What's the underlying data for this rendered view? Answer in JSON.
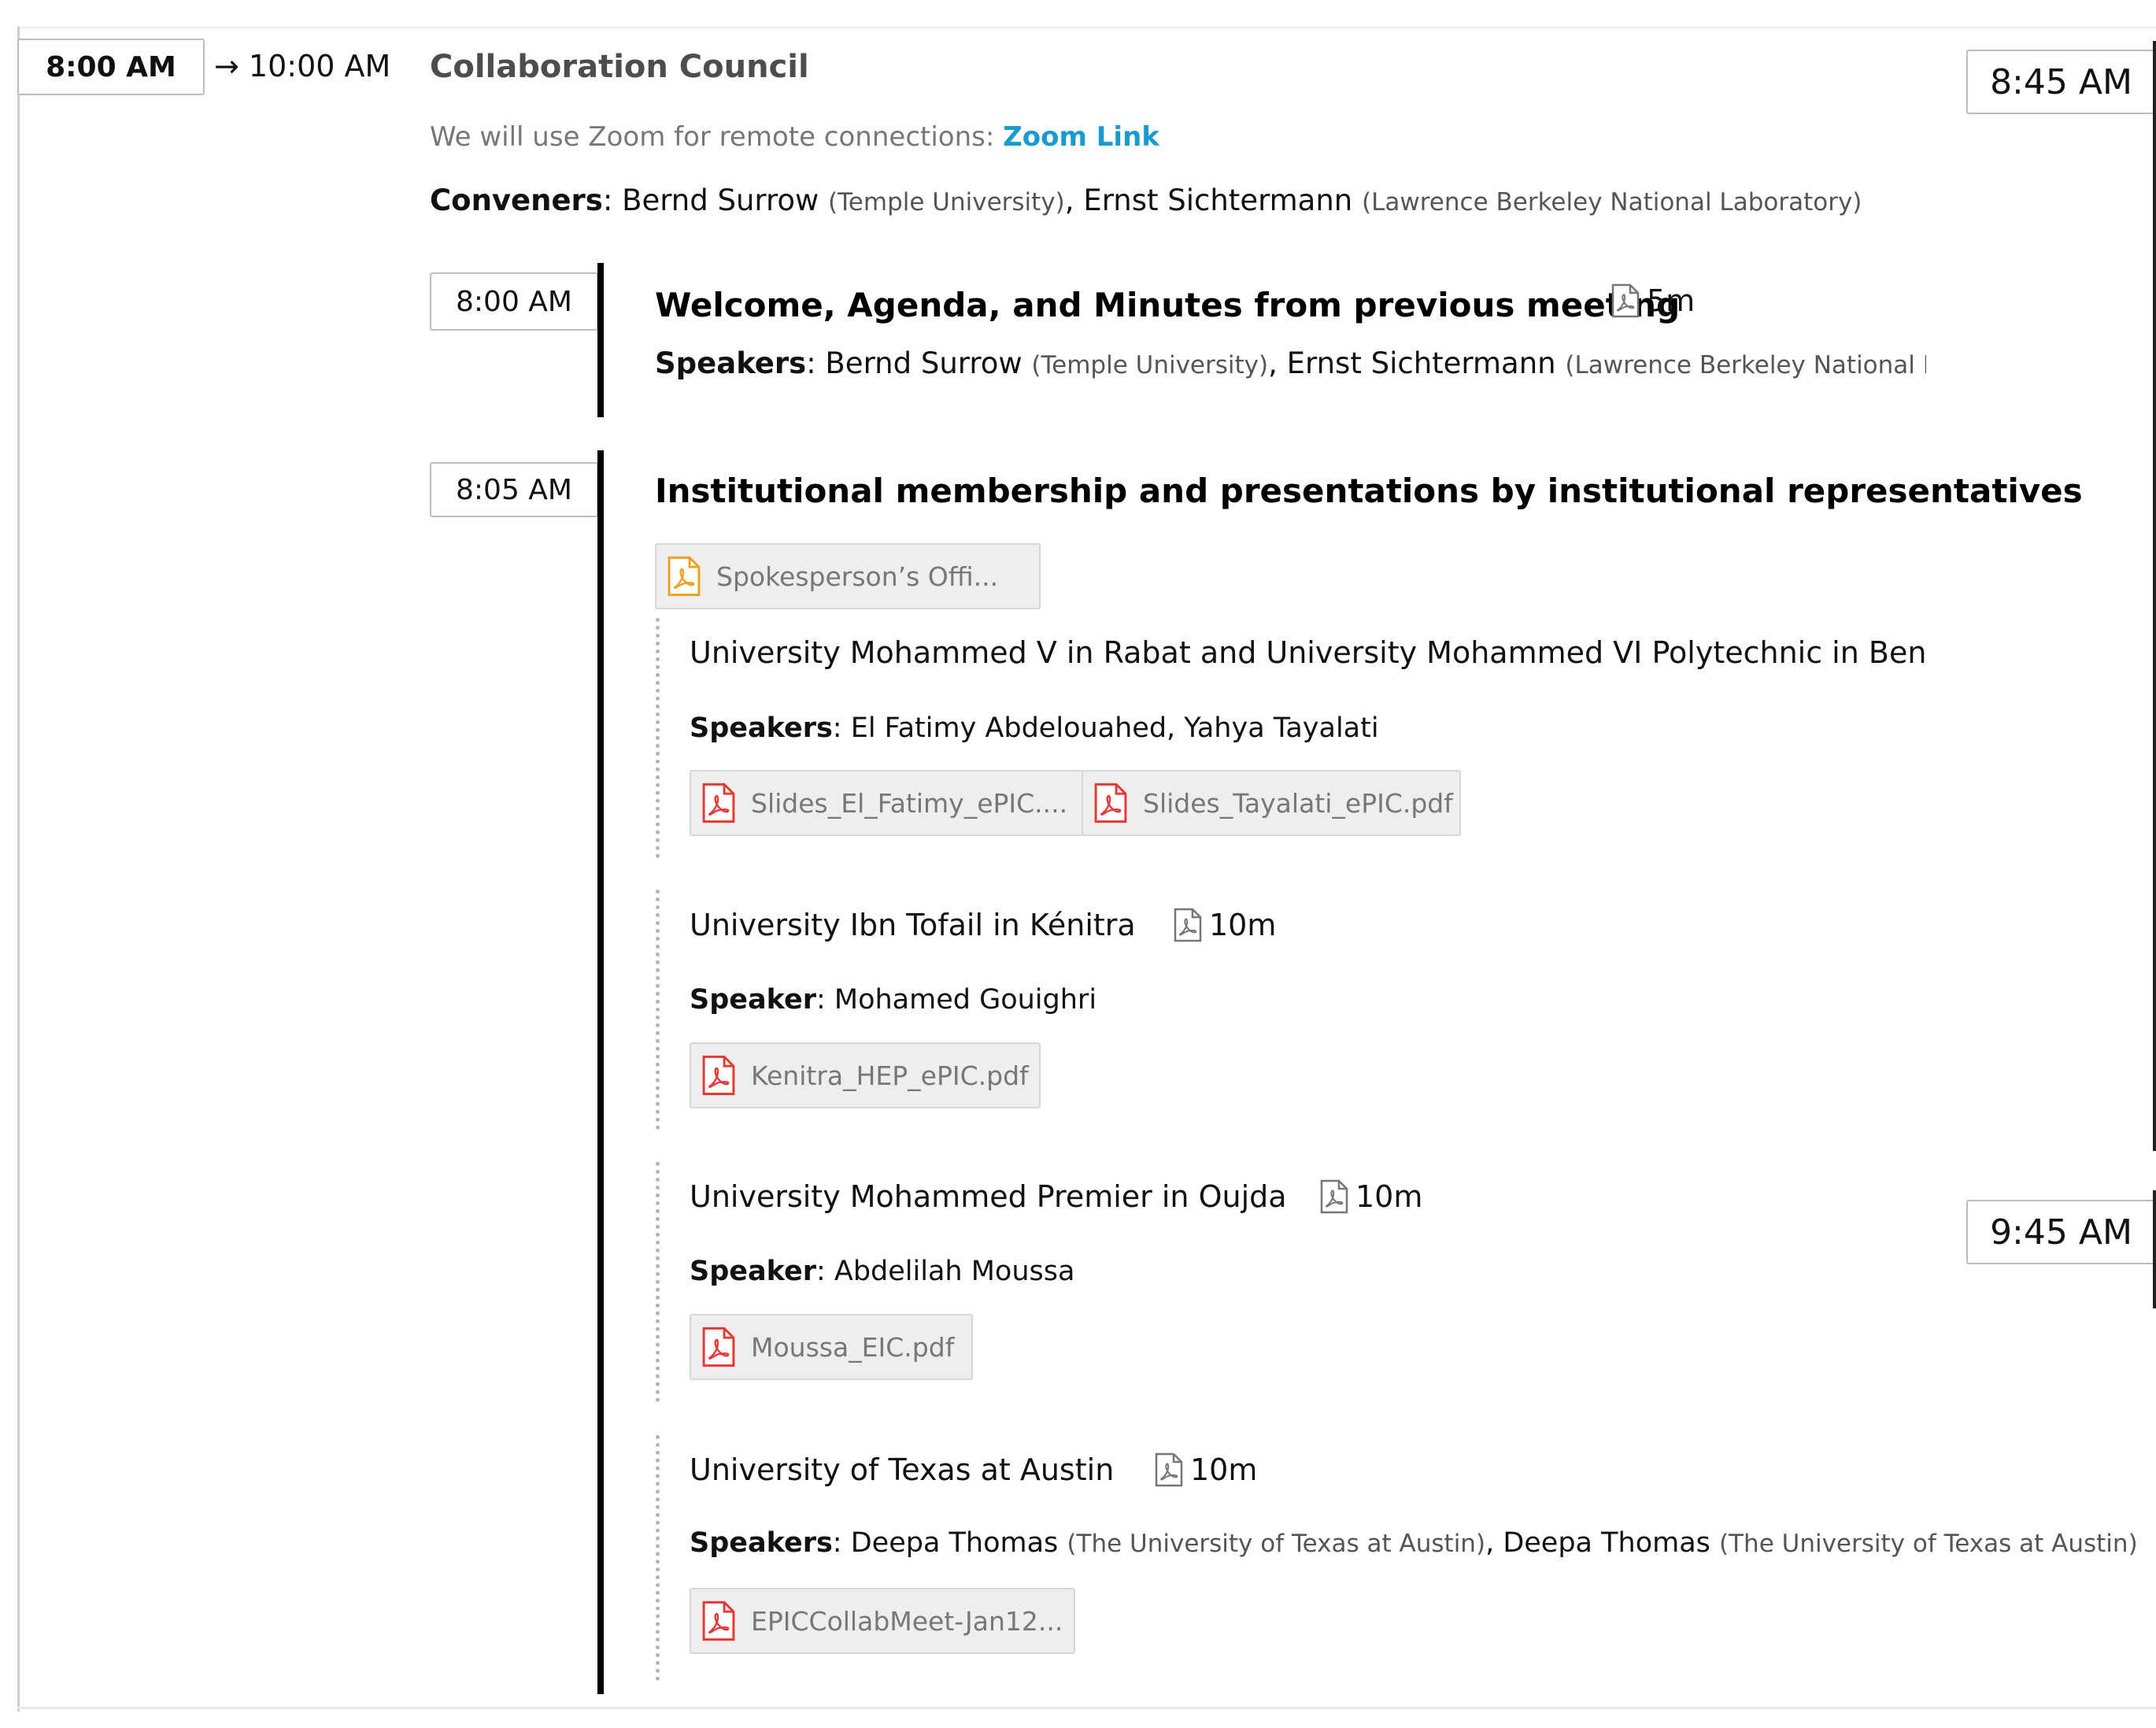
{
  "session": {
    "start": "8:00 AM",
    "end_arrow": "→ 10:00 AM",
    "title": "Collaboration Council",
    "zoom_prefix": "We will use Zoom for remote connections: ",
    "zoom_link": "Zoom Link",
    "conveners_label": "Conveners",
    "conveners": [
      {
        "name": "Bernd Surrow",
        "affiliation": "(Temple University)"
      },
      {
        "name": "Ernst Sichtermann",
        "affiliation": "(Lawrence Berkeley National Laboratory)"
      }
    ]
  },
  "time_markers": [
    "8:45 AM",
    "9:45 AM"
  ],
  "contributions": [
    {
      "time": "8:00 AM",
      "title": "Welcome, Agenda, and Minutes from previous meeting",
      "duration": "5m",
      "speakers_label": "Speakers",
      "speakers": [
        {
          "name": "Bernd Surrow",
          "affiliation": "(Temple University)"
        },
        {
          "name": "Ernst Sichtermann",
          "affiliation": "(Lawrence Berkeley National Lab"
        }
      ]
    },
    {
      "time": "8:05 AM",
      "title": "Institutional membership and presentations by institutional representatives",
      "attachment": "Spokesperson’s Offi...",
      "subcontributions": [
        {
          "title": "University Mohammed V in Rabat and University Mohammed VI Polytechnic in Bengu",
          "speakers_label": "Speakers",
          "speakers_text": "El Fatimy Abdelouahed, Yahya Tayalati",
          "attachments": [
            "Slides_El_Fatimy_ePIC....",
            "Slides_Tayalati_ePIC.pdf"
          ]
        },
        {
          "title": "University Ibn Tofail in Kénitra",
          "duration": "10m",
          "speakers_label": "Speaker",
          "speakers_text": "Mohamed Gouighri",
          "attachments": [
            "Kenitra_HEP_ePIC.pdf"
          ]
        },
        {
          "title": "University Mohammed Premier in Oujda",
          "duration": "10m",
          "speakers_label": "Speaker",
          "speakers_text": "Abdelilah Moussa",
          "attachments": [
            "Moussa_EIC.pdf"
          ]
        },
        {
          "title": "University of Texas at Austin",
          "duration": "10m",
          "speakers_label": "Speakers",
          "speakers": [
            {
              "name": "Deepa Thomas",
              "affiliation": "(The University of Texas at Austin)"
            },
            {
              "name": "Deepa Thomas",
              "affiliation": "(The University of Texas at Austin)"
            }
          ],
          "attachments": [
            "EPICCollabMeet-Jan12..."
          ]
        }
      ]
    }
  ],
  "colors": {
    "link": "#1a9bd0",
    "pdf_red": "#e53935",
    "pdf_orange": "#f0a020",
    "timeline": "#000000"
  }
}
